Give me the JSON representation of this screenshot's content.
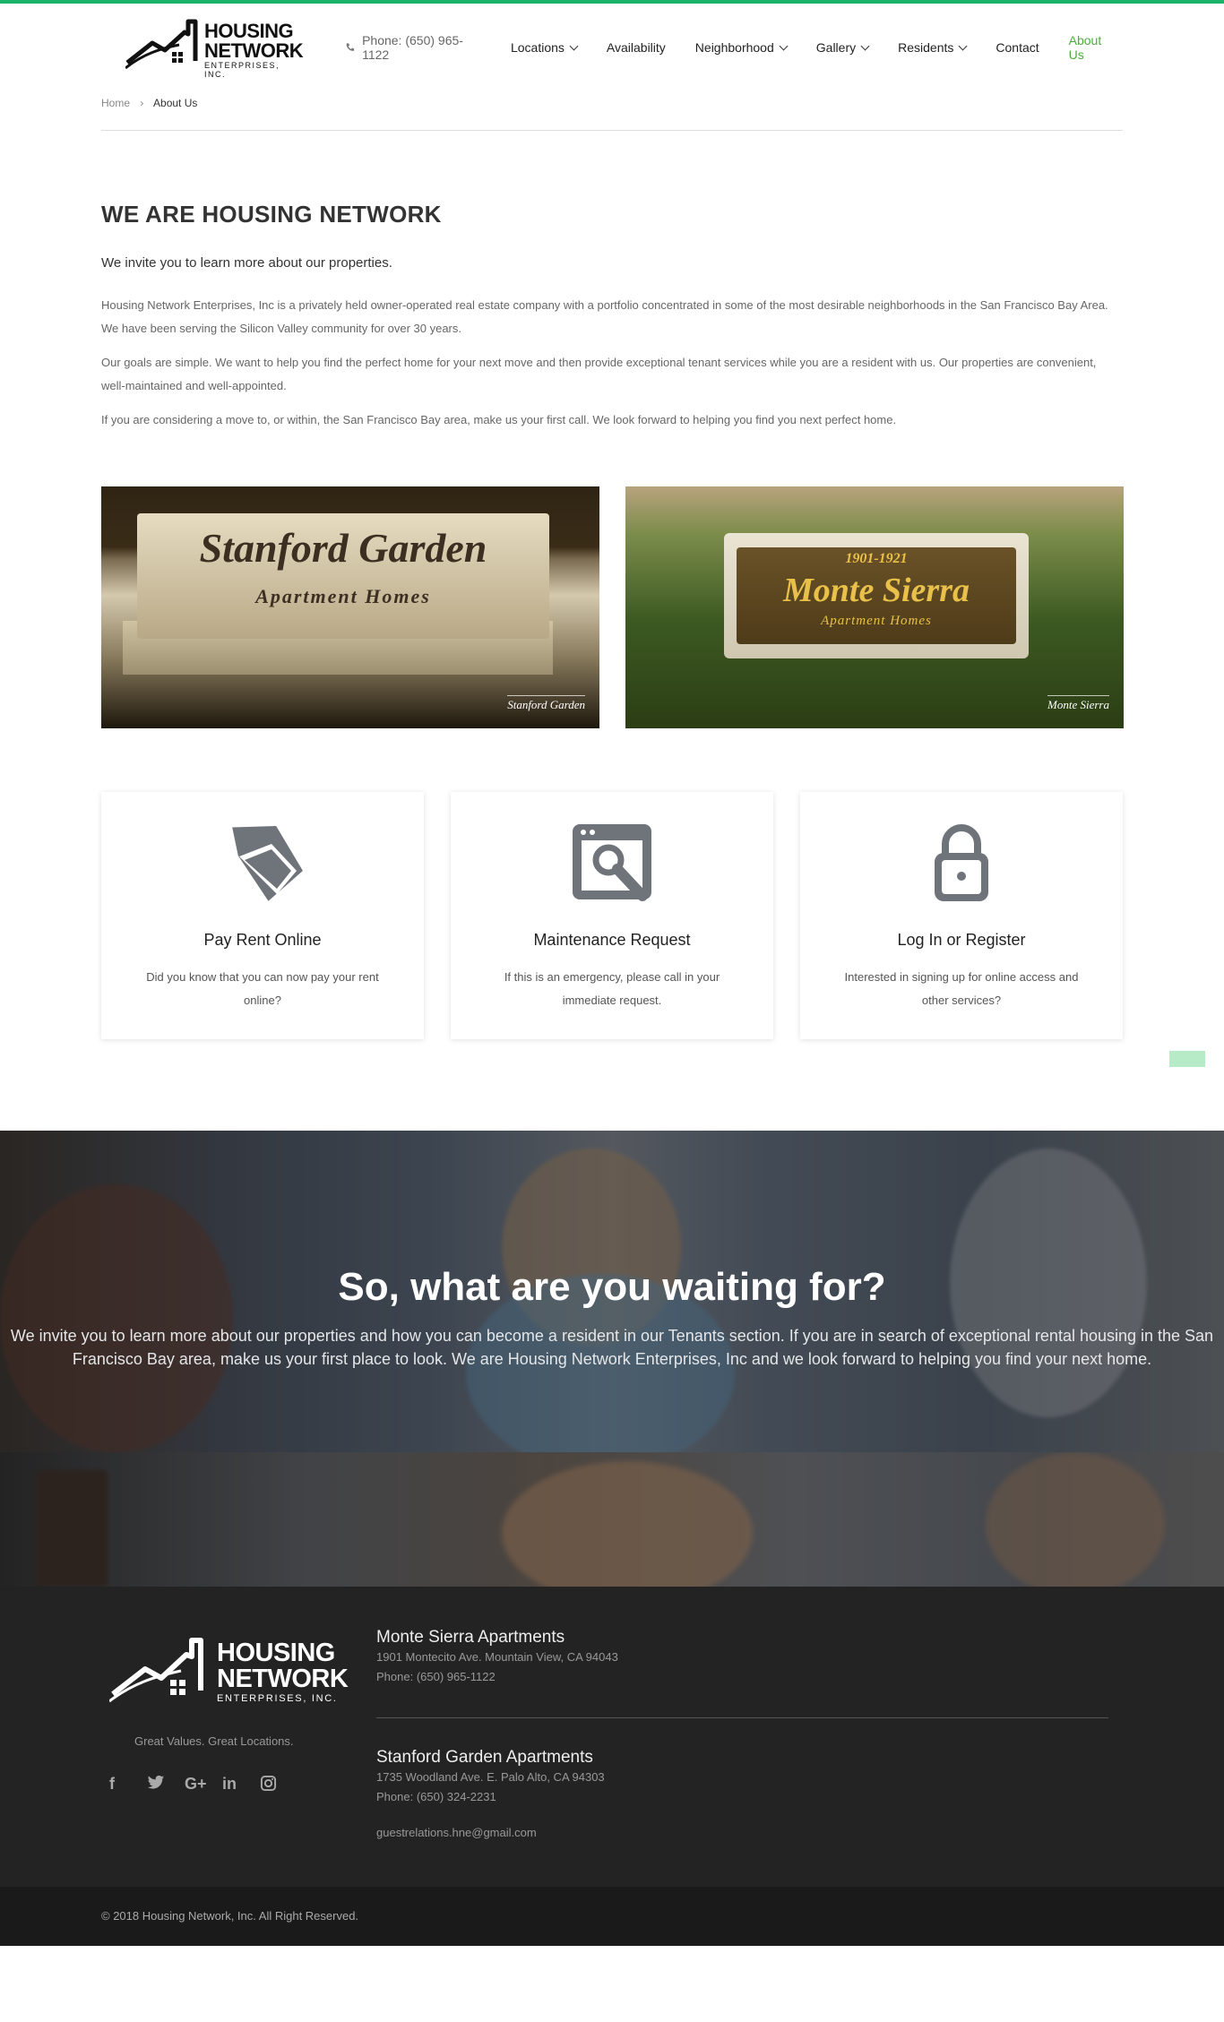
{
  "brand": {
    "line1": "HOUSING",
    "line2": "NETWORK",
    "line3": "ENTERPRISES, INC."
  },
  "nav": {
    "phone": "Phone: (650) 965-1122",
    "items": [
      "Locations",
      "Availability",
      "Neighborhood",
      "Gallery",
      "Residents",
      "Contact",
      "About Us"
    ],
    "active_color": "#4cae3b"
  },
  "breadcrumb": {
    "home": "Home",
    "sep": "›",
    "current": "About Us"
  },
  "intro": {
    "title": "WE ARE HOUSING NETWORK",
    "lead": "We invite you to learn more about our properties.",
    "p1": "Housing Network Enterprises, Inc is a privately held owner-operated real estate company with a portfolio concentrated in some of the most desirable neighborhoods in the San Francisco Bay Area. We have been serving the Silicon Valley community for over 30 years.",
    "p2": "Our goals are simple. We want to help you find the perfect home for your next move and then provide exceptional tenant services while you are a resident with us. Our properties are convenient, well-maintained and well-appointed.",
    "p3": "If you are considering a move to, or within, the San Francisco Bay area, make us your first call. We look forward to helping you find you next perfect home."
  },
  "photos": {
    "stanford": {
      "sign": "Stanford Garden",
      "sub": "Apartment Homes",
      "watermark": "Stanford Garden"
    },
    "monte": {
      "number": "1901-1921",
      "sign": "Monte Sierra",
      "sub": "Apartment Homes",
      "watermark": "Monte Sierra"
    }
  },
  "cards": [
    {
      "title": "Pay Rent Online",
      "text": "Did you know that you can now pay your rent online?",
      "icon": "tag-icon"
    },
    {
      "title": "Maintenance Request",
      "text": "If this is an emergency, please call in your immediate request.",
      "icon": "wrench-window-icon"
    },
    {
      "title": "Log In or Register",
      "text": "Interested in signing up for online access and other services?",
      "icon": "lock-icon"
    }
  ],
  "cta": {
    "title": "So, what are you waiting for?",
    "text": "We invite you to learn more about our properties and how you can become a resident in our Tenants section. If you are in search of exceptional rental housing in the San Francisco Bay area, make us your first place to look. We are Housing Network Enterprises, Inc and we look forward to helping you find your next home."
  },
  "footer": {
    "tagline": "Great Values. Great Locations.",
    "social": [
      "facebook-icon",
      "twitter-icon",
      "google-plus-icon",
      "linkedin-icon",
      "instagram-icon"
    ],
    "social_glyphs": [
      "f",
      "🐦",
      "G+",
      "in",
      "◎"
    ],
    "locations": [
      {
        "name": "Monte Sierra Apartments",
        "address": "1901 Montecito Ave. Mountain View, CA 94043",
        "phone": "Phone: (650) 965-1122"
      },
      {
        "name": "Stanford Garden Apartments",
        "address": "1735 Woodland Ave. E. Palo Alto, CA 94303",
        "phone": "Phone: (650) 324-2231"
      }
    ],
    "email": "guestrelations.hne@gmail.com",
    "copyright": "© 2018 Housing Network, Inc. All Right Reserved."
  }
}
